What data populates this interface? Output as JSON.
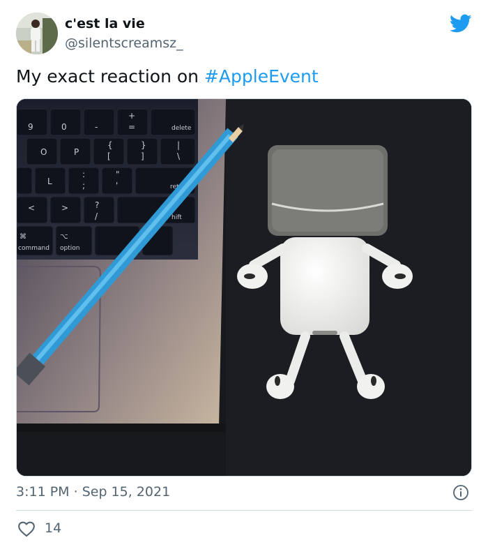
{
  "author": {
    "display_name": "c'est la vie ",
    "handle": "@silentscreamsz_"
  },
  "tweet": {
    "text_before": "My exact reaction on ",
    "hashtag": "#AppleEvent"
  },
  "media": {
    "keys": {
      "k1": "9",
      "k2": "0",
      "k3": "-",
      "k4": "+",
      "k5": "=",
      "k6": "delete",
      "k7": "O",
      "k8": "P",
      "k9": "{",
      "k10": "[",
      "k11": "}",
      "k12": "]",
      "k13": "|",
      "k14": "\\",
      "k15": "L",
      "k16": ":",
      "k17": ";",
      "k18": "\"",
      "k19": "'",
      "k20": "retu",
      "k21": "<",
      "k22": ">",
      "k23": "?",
      "k24": "/",
      "k25": "hift",
      "k26": "⌘",
      "k27": "command",
      "k28": "⌥",
      "k29": "option"
    }
  },
  "footer": {
    "time": "3:11 PM",
    "separator": "·",
    "date": "Sep 15, 2021",
    "like_count": "14"
  },
  "colors": {
    "accent": "#1d9bf0",
    "text_primary": "#0f1419",
    "text_secondary": "#536471",
    "divider": "#cfd9de"
  },
  "icons": {
    "brand": "twitter-bird-icon",
    "info": "info-icon",
    "like": "heart-icon"
  }
}
